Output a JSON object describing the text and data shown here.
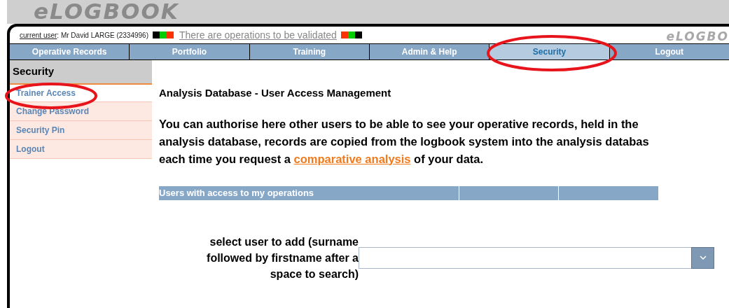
{
  "logo": "eLOGBOOK",
  "header": {
    "user_label": "current user",
    "user_value": ": Mr David LARGE (2334996)",
    "notice": "There are operations to be validated",
    "watermark": "eLOGBO"
  },
  "nav": [
    {
      "label": "Operative Records",
      "selected": false
    },
    {
      "label": "Portfolio",
      "selected": false
    },
    {
      "label": "Training",
      "selected": false
    },
    {
      "label": "Admin & Help",
      "selected": false
    },
    {
      "label": "Security",
      "selected": true
    },
    {
      "label": "Logout",
      "selected": false
    }
  ],
  "sidebar": {
    "title": "Security",
    "items": [
      {
        "label": "Trainer Access",
        "selected": true
      },
      {
        "label": "Change Password",
        "selected": false
      },
      {
        "label": "Security Pin",
        "selected": false
      },
      {
        "label": "Logout",
        "selected": false
      }
    ]
  },
  "content": {
    "title": "Analysis Database - User Access Management",
    "intro": {
      "before": "You can authorise here other users to be able to see your operative records, held in the\nanalysis database, records are copied from the logbook system into the analysis databas\neach time you request a ",
      "link": "comparative analysis",
      "after": " of your data."
    },
    "table": {
      "columns": [
        {
          "label": "Users with access to my operations"
        },
        {},
        {}
      ]
    },
    "select": {
      "label": "select user to add (surname followed by firstname after a space to search)"
    }
  }
}
